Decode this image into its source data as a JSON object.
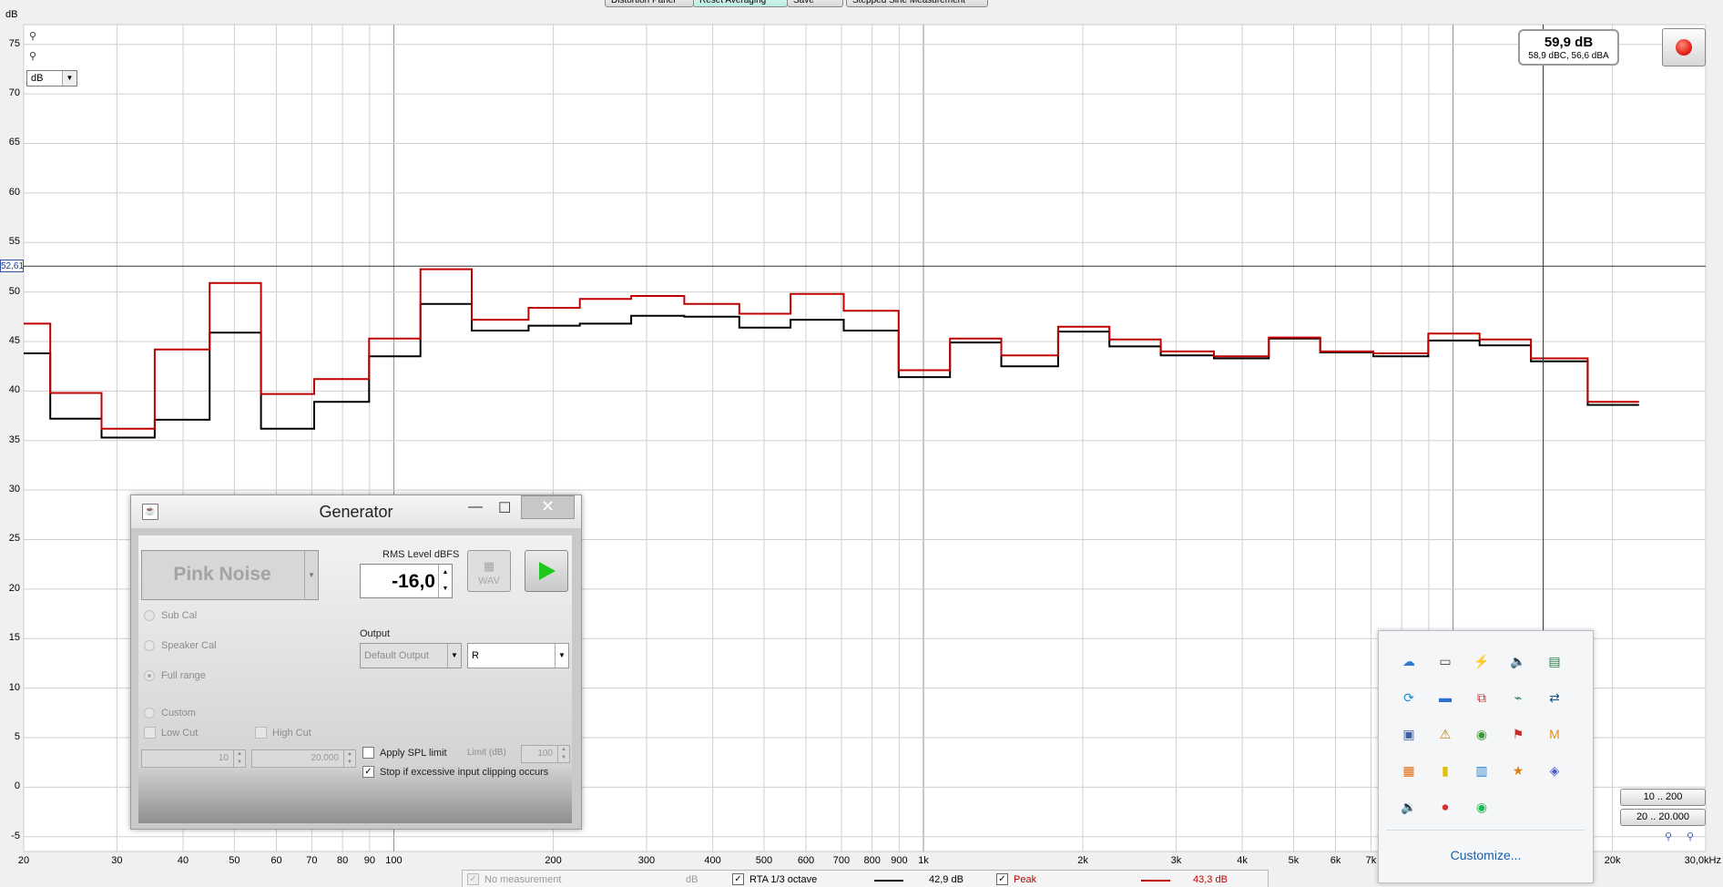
{
  "toolbar": {
    "buttons": [
      {
        "label": "Distortion Panel",
        "active": false
      },
      {
        "label": "Reset Averaging",
        "active": true
      },
      {
        "label": "Save",
        "active": false
      },
      {
        "label": "Stepped Sine Measurement",
        "active": false
      }
    ]
  },
  "graph": {
    "y_unit": "dB",
    "unit_select": "dB",
    "cursor_value": "52,61",
    "cursor_level_db": 52.61,
    "cursor_freq_hz": 14800,
    "readout_main": "59,9 dB",
    "readout_sub": "58,9 dBC, 56,6 dBA",
    "y_ticks": [
      "75",
      "70",
      "65",
      "60",
      "55",
      "50",
      "45",
      "40",
      "35",
      "30",
      "25",
      "20",
      "15",
      "10",
      "5",
      "0",
      "-5"
    ],
    "x_ticks": [
      "20",
      "30",
      "40",
      "50",
      "60",
      "70",
      "80",
      "90",
      "100",
      "200",
      "300",
      "400",
      "500",
      "600",
      "700",
      "800",
      "900",
      "1k",
      "2k",
      "3k",
      "4k",
      "5k",
      "6k",
      "7k",
      "20k",
      "30,0kHz"
    ],
    "range_buttons": [
      "10 .. 200",
      "20 .. 20.000"
    ]
  },
  "chart_data": {
    "type": "line",
    "title": "",
    "xlabel": "",
    "ylabel": "dB",
    "xscale": "log",
    "xlim": [
      20,
      30000
    ],
    "ylim": [
      -6.5,
      77
    ],
    "grid": true,
    "x_centers": [
      20,
      25,
      31.5,
      40,
      50,
      63,
      80,
      100,
      125,
      160,
      200,
      250,
      315,
      400,
      500,
      630,
      800,
      1000,
      1250,
      1600,
      2000,
      2500,
      3150,
      4000,
      5000,
      6300,
      8000,
      10000,
      12500,
      16000,
      20000
    ],
    "series": [
      {
        "name": "RTA 1/3 octave",
        "color": "#000000",
        "values": [
          43.8,
          37.2,
          35.3,
          37.1,
          45.9,
          36.2,
          38.9,
          43.5,
          48.8,
          46.1,
          46.6,
          46.8,
          47.6,
          47.5,
          46.4,
          47.2,
          46.1,
          41.4,
          44.9,
          42.5,
          46.0,
          44.5,
          43.6,
          43.3,
          45.3,
          43.9,
          43.5,
          45.1,
          44.6,
          43.0,
          38.6
        ]
      },
      {
        "name": "Peak",
        "color": "#c00000",
        "values": [
          46.8,
          39.8,
          36.2,
          44.2,
          50.9,
          39.7,
          41.2,
          45.3,
          52.3,
          47.2,
          48.4,
          49.3,
          49.6,
          48.8,
          47.8,
          49.8,
          48.1,
          42.1,
          45.3,
          43.6,
          46.5,
          45.2,
          44.0,
          43.5,
          45.4,
          44.0,
          43.8,
          45.8,
          45.2,
          43.3,
          38.9
        ]
      }
    ]
  },
  "generator": {
    "title": "Generator",
    "signal": "Pink Noise",
    "rms_label": "RMS Level dBFS",
    "rms_value": "-16,0",
    "wav_label": "WAV",
    "radios": [
      {
        "label": "Sub Cal",
        "selected": false
      },
      {
        "label": "Speaker Cal",
        "selected": false
      },
      {
        "label": "Full range",
        "selected": true
      },
      {
        "label": "Custom",
        "selected": false
      }
    ],
    "low_cut_label": "Low Cut",
    "high_cut_label": "High Cut",
    "low_cut_value": "10",
    "high_cut_value": "20.000",
    "output_label": "Output",
    "output_device": "Default Output",
    "output_channel": "R",
    "spl_limit_label": "Apply SPL limit",
    "spl_limit_checked": false,
    "limit_label": "Limit (dB)",
    "limit_value": "100",
    "stop_clip_label": "Stop if excessive input clipping occurs",
    "stop_clip_checked": true
  },
  "tray": {
    "icons": [
      "cloud-alert-icon",
      "display-icon",
      "power-icon",
      "speaker-icon",
      "network-icon",
      "sync-icon",
      "chat-icon",
      "remote-icon",
      "usb-icon",
      "transfer-icon",
      "computer-icon",
      "cloud-warning-icon",
      "chrome-icon",
      "flag-icon",
      "m-icon",
      "grid-icon",
      "sticky-note-icon",
      "monitor-icon",
      "star-icon",
      "teams-icon",
      "volume-icon",
      "record-icon",
      "spotify-icon"
    ],
    "customize": "Customize..."
  },
  "legend": {
    "no_measurement": "No measurement",
    "no_measurement_unit": "dB",
    "rta_label": "RTA 1/3 octave",
    "rta_value": "42,9 dB",
    "peak_label": "Peak",
    "peak_value": "43,3 dB"
  }
}
